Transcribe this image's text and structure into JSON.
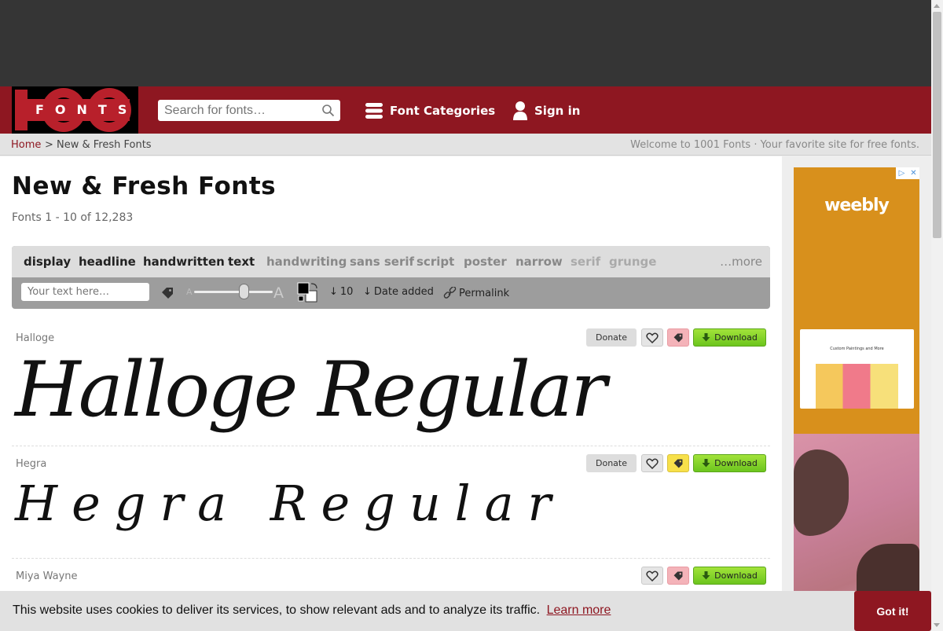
{
  "header": {
    "logo_text": "FONTS",
    "search_placeholder": "Search for fonts…",
    "categories_label": "Font Categories",
    "signin_label": "Sign in"
  },
  "breadcrumb": {
    "home": "Home",
    "separator": ">",
    "current": "New & Fresh Fonts",
    "welcome": "Welcome to 1001 Fonts · Your favorite site for free fonts."
  },
  "page": {
    "title": "New & Fresh Fonts",
    "count": "Fonts 1 - 10 of 12,283"
  },
  "filters": {
    "tags": [
      {
        "label": "display",
        "active": true
      },
      {
        "label": "headline",
        "active": true
      },
      {
        "label": "handwritten",
        "active": true
      },
      {
        "label": "text",
        "active": true
      },
      {
        "label": "handwriting",
        "active": false
      },
      {
        "label": "sans serif",
        "active": false
      },
      {
        "label": "script",
        "active": false
      },
      {
        "label": "poster",
        "active": false
      },
      {
        "label": "narrow",
        "active": false
      },
      {
        "label": "serif",
        "active": false
      },
      {
        "label": "grunge",
        "active": false
      }
    ],
    "more_label": "…more",
    "preview_placeholder": "Your text here…",
    "size_small_label": "A",
    "size_large_label": "A",
    "size_level": 0.65,
    "per_page": "10",
    "sort_label": "Date added",
    "permalink_label": "Permalink"
  },
  "fonts": [
    {
      "name": "Halloge",
      "preview": "Halloge Regular",
      "donate": "Donate",
      "download": "Download",
      "tag_color": "#f4b3b9"
    },
    {
      "name": "Hegra",
      "preview": "Hegra Regular",
      "donate": "Donate",
      "download": "Download",
      "tag_color": "#f7e04a"
    },
    {
      "name": "Miya Wayne",
      "preview": "",
      "download": "Download",
      "tag_color": "#f4b3b9"
    }
  ],
  "ad": {
    "brand": "weebly",
    "screenshot_caption": "Custom Paintings and More",
    "adchoices_label": "▷",
    "close_label": "✕"
  },
  "cookie": {
    "message": "This website uses cookies to deliver its services, to show relevant ads and to analyze its traffic.",
    "learn_more": "Learn more",
    "accept": "Got it!"
  },
  "colors": {
    "brand_red": "#8e1721",
    "download_green": "#8fd52d",
    "top_band": "#353535"
  }
}
